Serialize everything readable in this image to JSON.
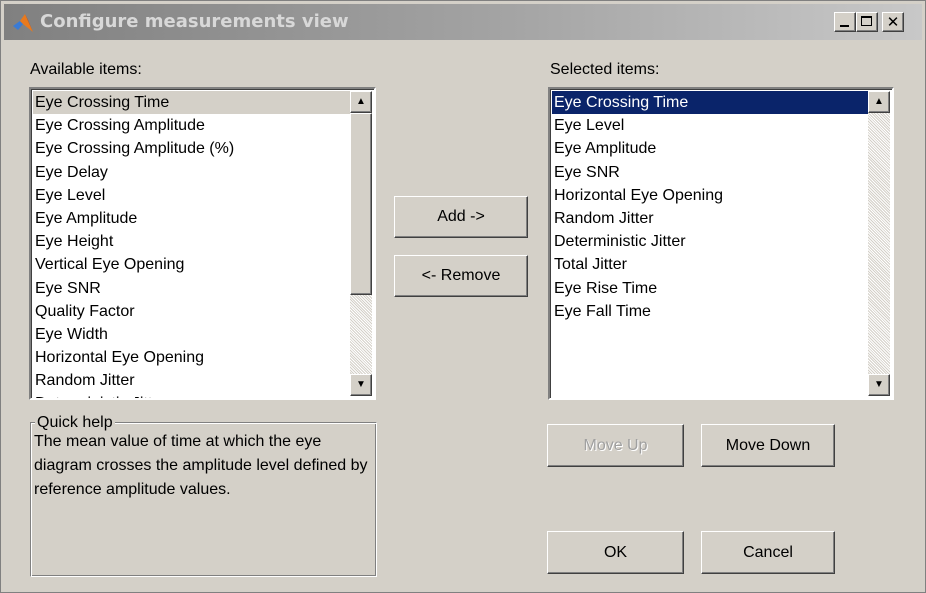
{
  "window": {
    "title": "Configure measurements view",
    "minimize_symbol": "_",
    "maximize_symbol": "□",
    "close_symbol": "✕",
    "icon": "matlab-logo-icon"
  },
  "available": {
    "label": "Available items:",
    "items": [
      "Eye Crossing Time",
      "Eye Crossing Amplitude",
      "Eye Crossing Amplitude (%)",
      "Eye Delay",
      "Eye Level",
      "Eye Amplitude",
      "Eye Height",
      "Vertical Eye Opening",
      "Eye SNR",
      "Quality Factor",
      "Eye Width",
      "Horizontal Eye Opening",
      "Random Jitter",
      "Deterministic Jitter"
    ],
    "selected_index": 0
  },
  "selected": {
    "label": "Selected items:",
    "items": [
      "Eye Crossing Time",
      "Eye Level",
      "Eye Amplitude",
      "Eye SNR",
      "Horizontal Eye Opening",
      "Random Jitter",
      "Deterministic Jitter",
      "Total Jitter",
      "Eye Rise Time",
      "Eye Fall Time"
    ],
    "selected_index": 0
  },
  "buttons": {
    "add": "Add ->",
    "remove": "<- Remove",
    "move_up": "Move Up",
    "move_down": "Move Down",
    "ok": "OK",
    "cancel": "Cancel"
  },
  "quick_help": {
    "title": "Quick help",
    "text": "The mean value of time at which the eye diagram crosses the amplitude level defined by reference amplitude values."
  },
  "colors": {
    "selection_blue": "#0a246a",
    "dialog_face": "#d4d0c8"
  }
}
